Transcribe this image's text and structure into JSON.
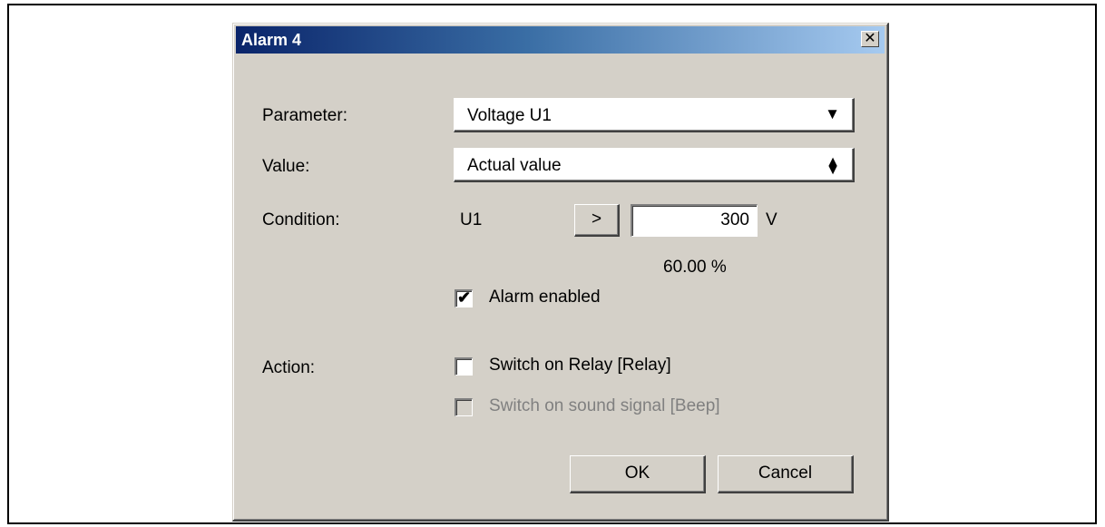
{
  "dialog": {
    "title": "Alarm 4",
    "close_glyph": "✕"
  },
  "form": {
    "parameter_label": "Parameter:",
    "parameter_value": "Voltage U1",
    "value_label": "Value:",
    "value_value": "Actual value",
    "condition_label": "Condition:",
    "condition_variable": "U1",
    "condition_operator": ">",
    "condition_threshold": "300",
    "condition_unit": "V",
    "condition_percent": "60.00 %",
    "alarm_enabled_label": "Alarm enabled",
    "alarm_enabled_checked": true,
    "action_label": "Action:",
    "relay_label": "Switch on Relay [Relay]",
    "relay_checked": false,
    "beep_label": "Switch on sound signal [Beep]",
    "beep_checked": false,
    "beep_disabled": true
  },
  "buttons": {
    "ok": "OK",
    "cancel": "Cancel"
  },
  "icons": {
    "dropdown": "chevron-down-icon",
    "spinner": "up-down-icon",
    "check": "checkmark-icon",
    "close": "close-icon"
  }
}
